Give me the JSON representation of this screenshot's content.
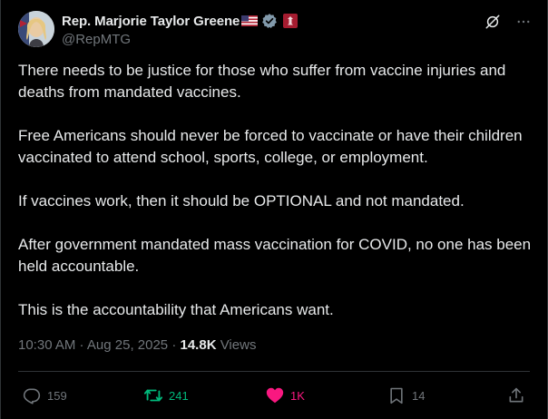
{
  "author": {
    "display_name": "Rep. Marjorie Taylor Greene",
    "handle": "@RepMTG",
    "flag_icon": "us-flag-icon",
    "verified_icon": "verified-badge-icon",
    "affiliation_icon": "house-seal-icon"
  },
  "body": [
    "There needs to be justice for those who suffer from vaccine injuries and deaths from mandated vaccines.",
    "Free Americans should never be forced to vaccinate or have their children vaccinated to attend school, sports, college, or employment.",
    "If vaccines work, then it should be OPTIONAL and not mandated.",
    "After government mandated mass vaccination for COVID, no one has been held accountable.",
    "This is the accountability that Americans want."
  ],
  "meta": {
    "time": "10:30 AM",
    "separator": " · ",
    "date": "Aug 25, 2025",
    "views_count": "14.8K",
    "views_label": " Views"
  },
  "stats": {
    "replies": "159",
    "reposts": "241",
    "likes": "1K",
    "bookmarks": "14"
  },
  "colors": {
    "background": "#000000",
    "text": "#e7e9ea",
    "muted": "#71767b",
    "repost_active": "#00ba7c",
    "like_active": "#f91880",
    "verified": "#829aab"
  }
}
